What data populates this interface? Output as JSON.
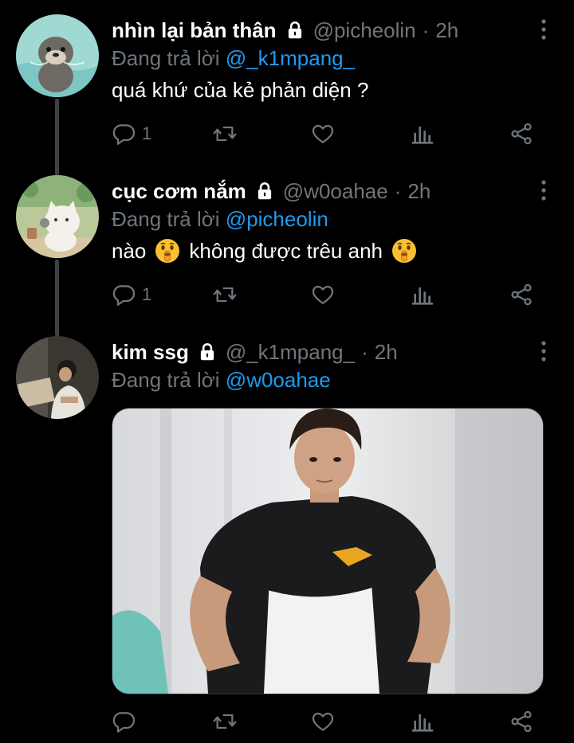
{
  "tweets": [
    {
      "display_name": "nhìn lại bản thân",
      "handle": "@picheolin",
      "separator": "·",
      "time": "2h",
      "reply_prefix": "Đang trả lời",
      "reply_to": "@_k1mpang_",
      "text": "quá khứ của kẻ phản diện ?",
      "reply_count": "1",
      "protected": true
    },
    {
      "display_name": "cục cơm nắm",
      "handle": "@w0oahae",
      "separator": "·",
      "time": "2h",
      "reply_prefix": "Đang trả lời",
      "reply_to": "@picheolin",
      "text_before": "nào",
      "text_middle": "không được trêu anh",
      "emoji": "shushing-face",
      "reply_count": "1",
      "protected": true
    },
    {
      "display_name": "kim ssg",
      "handle": "@_k1mpang_",
      "separator": "·",
      "time": "2h",
      "reply_prefix": "Đang trả lời",
      "reply_to": "@w0oahae",
      "reply_count": "",
      "protected": true,
      "has_media": true
    }
  ],
  "colors": {
    "background": "#000000",
    "muted": "#6e767d",
    "link": "#1d9bf0",
    "thread_line": "#3d4248"
  },
  "icons": [
    "reply-icon",
    "retweet-icon",
    "like-icon",
    "analytics-icon",
    "share-icon",
    "lock-icon",
    "more-icon"
  ]
}
